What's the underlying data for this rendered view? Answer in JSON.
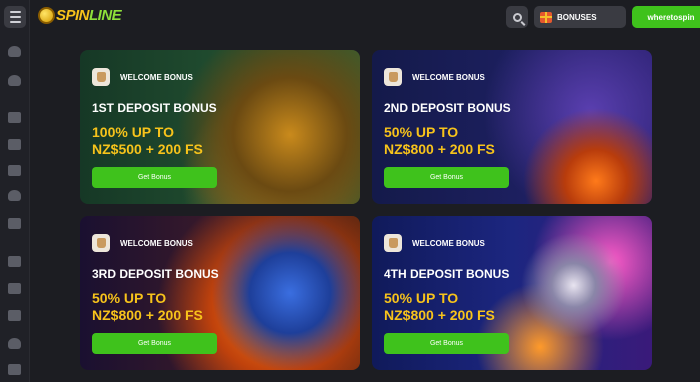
{
  "header": {
    "logo_text_a": "SPIN",
    "logo_text_b": "LINE",
    "bonuses_label": "BONUSES",
    "cta_label": "wheretospin"
  },
  "sidebar": {
    "icons": [
      "menu-icon",
      "user-icon",
      "user-icon",
      "cards-icon",
      "chips-icon",
      "basket-icon",
      "shield-icon",
      "slot-icon",
      "grid-icon",
      "ticket-icon",
      "gift-icon",
      "crown-icon",
      "trophy-icon",
      "flag-icon"
    ]
  },
  "cards": [
    {
      "badge": "WELCOME BONUS",
      "title": "1ST DEPOSIT BONUS",
      "offer_line1": "100% UP TO",
      "offer_line2": "NZ$500 + 200 FS",
      "button": "Get Bonus"
    },
    {
      "badge": "WELCOME BONUS",
      "title": "2ND DEPOSIT BONUS",
      "offer_line1": "50% UP TO",
      "offer_line2": "NZ$800 + 200 FS",
      "button": "Get Bonus"
    },
    {
      "badge": "WELCOME BONUS",
      "title": "3RD DEPOSIT BONUS",
      "offer_line1": "50% UP TO",
      "offer_line2": "NZ$800 + 200 FS",
      "button": "Get Bonus"
    },
    {
      "badge": "WELCOME BONUS",
      "title": "4TH DEPOSIT BONUS",
      "offer_line1": "50% UP TO",
      "offer_line2": "NZ$800 + 200 FS",
      "button": "Get Bonus"
    }
  ],
  "colors": {
    "accent_green": "#3fc21c",
    "offer_yellow": "#f7c31b",
    "background": "#1c1d22"
  }
}
